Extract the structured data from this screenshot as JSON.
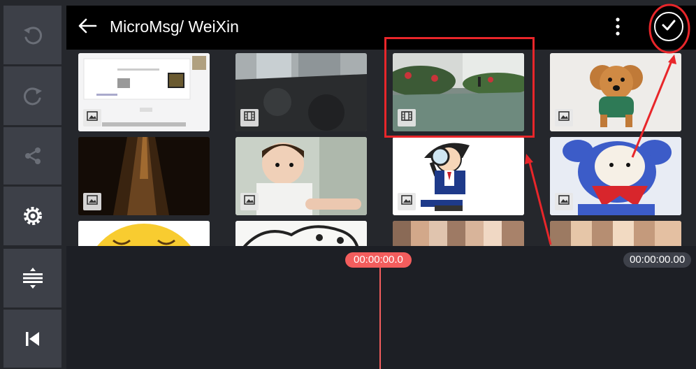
{
  "header": {
    "title": "MicroMsg/ WeiXin",
    "back_icon": "arrow-left-icon",
    "more_icon": "more-vertical-icon",
    "confirm_icon": "check-icon"
  },
  "sidebar": {
    "items": [
      {
        "name": "undo",
        "icon": "undo-icon"
      },
      {
        "name": "redo",
        "icon": "redo-icon"
      },
      {
        "name": "share",
        "icon": "share-icon"
      },
      {
        "name": "settings",
        "icon": "gear-icon"
      },
      {
        "name": "layers",
        "icon": "layer-adjust-icon"
      },
      {
        "name": "skip-to-start",
        "icon": "skip-start-icon"
      }
    ]
  },
  "media": {
    "items": [
      {
        "type": "image",
        "desc": "chat screenshot",
        "badge_icon": "image-icon"
      },
      {
        "type": "video",
        "desc": "marble floor",
        "badge_icon": "film-icon"
      },
      {
        "type": "video",
        "desc": "courtyard with person",
        "badge_icon": "film-icon",
        "highlighted": true
      },
      {
        "type": "image",
        "desc": "poodle dog",
        "badge_icon": "image-icon"
      },
      {
        "type": "image",
        "desc": "dark canyon",
        "badge_icon": "image-icon"
      },
      {
        "type": "image",
        "desc": "child",
        "badge_icon": "image-icon"
      },
      {
        "type": "image",
        "desc": "cartoon detective",
        "badge_icon": "image-icon"
      },
      {
        "type": "image",
        "desc": "meme cartoon",
        "badge_icon": "image-icon"
      },
      {
        "type": "image",
        "desc": "emoji face",
        "badge_icon": "image-icon"
      },
      {
        "type": "image",
        "desc": "sketch",
        "badge_icon": "image-icon"
      },
      {
        "type": "image",
        "desc": "blurred",
        "badge_icon": "image-icon"
      },
      {
        "type": "image",
        "desc": "blurred",
        "badge_icon": "image-icon"
      }
    ]
  },
  "timeline": {
    "current_time": "00:00:00.0",
    "total_time": "00:00:00.00"
  },
  "colors": {
    "accent": "#f35d5d",
    "annotation": "#e8262a",
    "panel": "#3d4048",
    "background": "#25272c"
  }
}
